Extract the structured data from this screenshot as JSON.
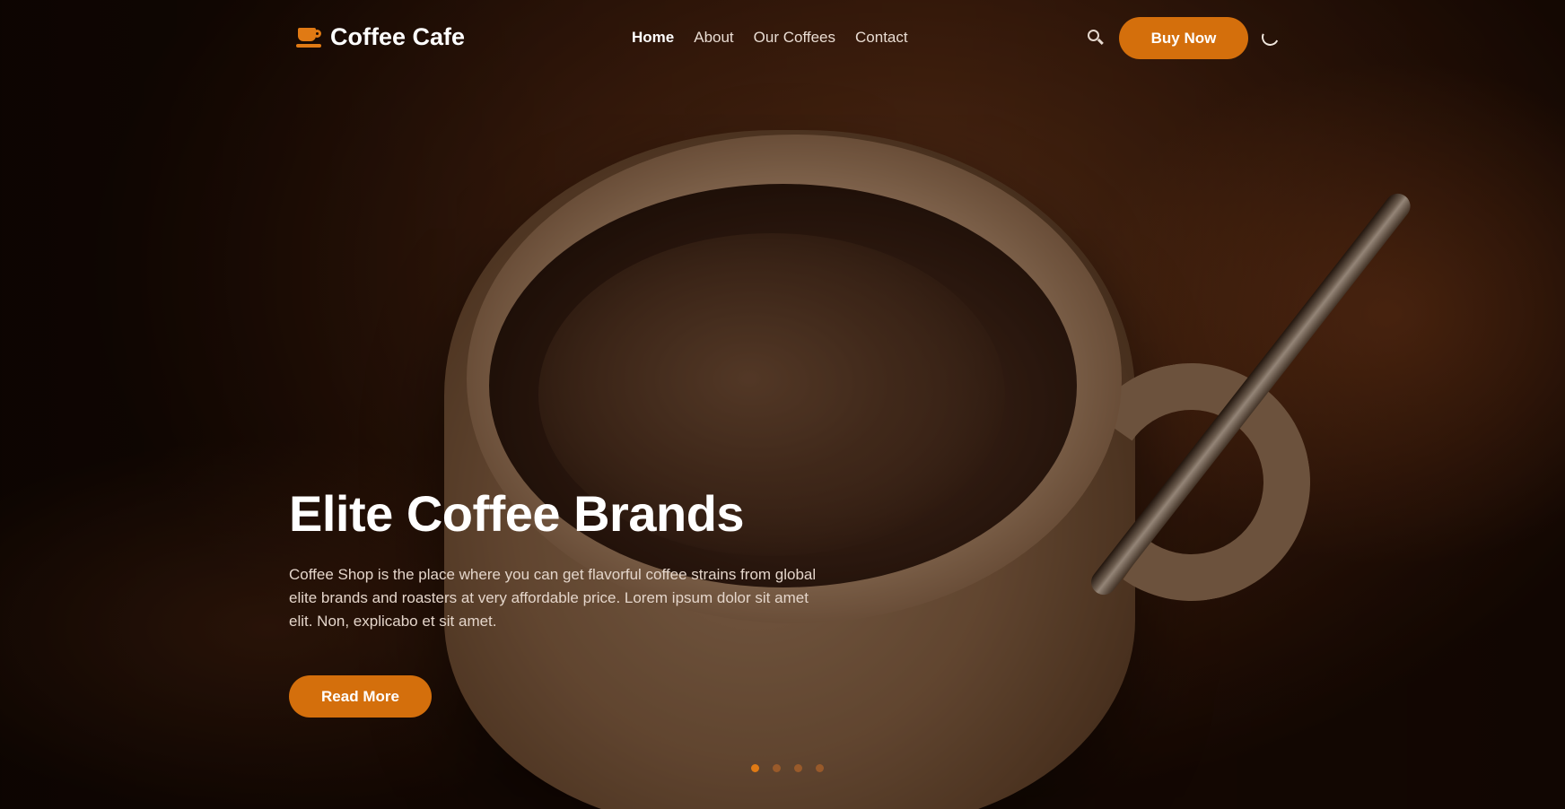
{
  "brand": {
    "name": "Coffee Cafe",
    "icon": "coffee-cup-icon",
    "accent_color": "#d46f0c"
  },
  "nav": {
    "links": [
      {
        "label": "Home",
        "active": true
      },
      {
        "label": "About",
        "active": false
      },
      {
        "label": "Our Coffees",
        "active": false
      },
      {
        "label": "Contact",
        "active": false
      }
    ],
    "search_icon": "search-icon",
    "buy_label": "Buy Now",
    "theme_icon": "moon-icon"
  },
  "hero": {
    "title": "Elite Coffee Brands",
    "description": "Coffee Shop is the place where you can get flavorful coffee strains from global elite brands and roasters at very affordable price. Lorem ipsum dolor sit amet elit. Non, explicabo et sit amet.",
    "cta_label": "Read More"
  },
  "carousel": {
    "total_slides": 4,
    "active_index": 0
  }
}
